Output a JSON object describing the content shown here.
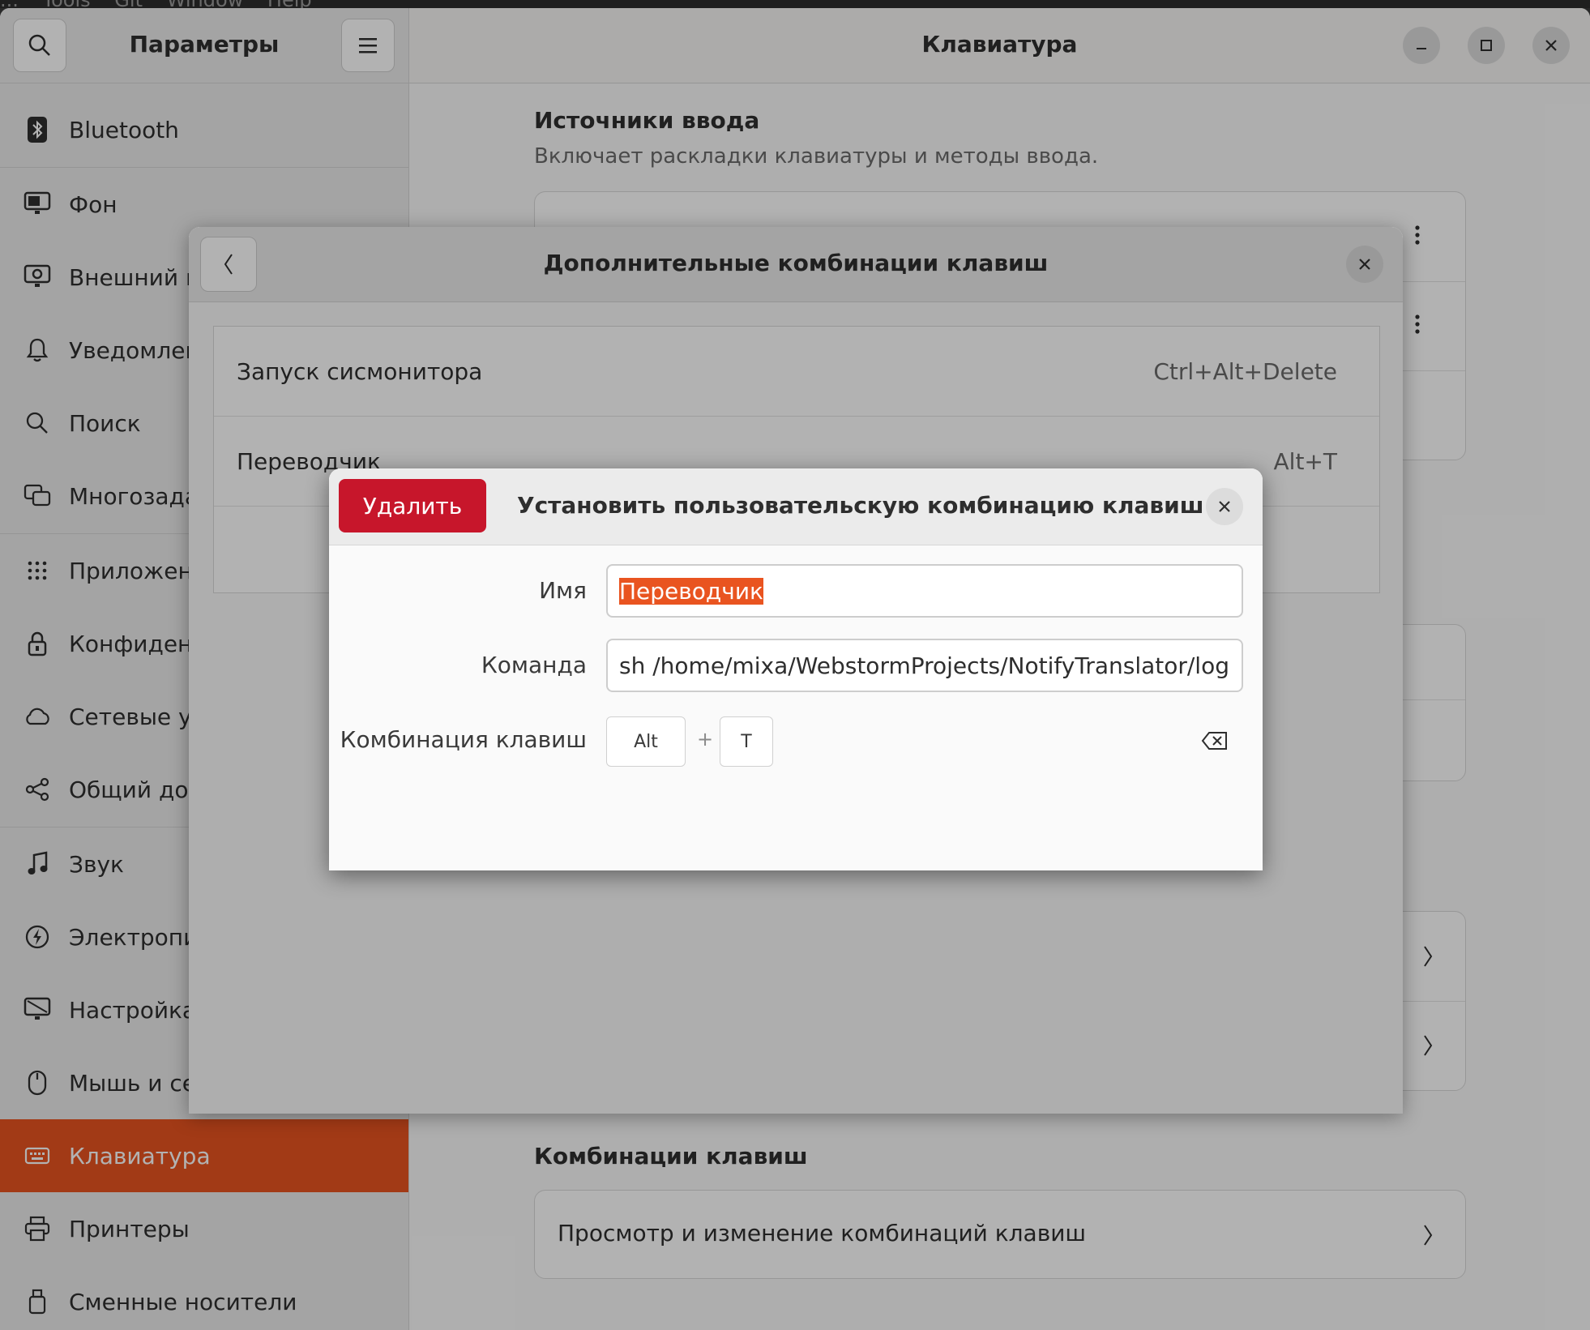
{
  "menubar": {
    "items": [
      "...",
      "Tools",
      "Git",
      "Window",
      "Help"
    ]
  },
  "sidebar": {
    "title": "Параметры",
    "items": [
      {
        "label": "Bluetooth",
        "icon": "bluetooth-icon"
      },
      {
        "label": "Фон",
        "icon": "background-icon"
      },
      {
        "label": "Внешний вид",
        "icon": "appearance-icon"
      },
      {
        "label": "Уведомления",
        "icon": "bell-icon"
      },
      {
        "label": "Поиск",
        "icon": "search-icon"
      },
      {
        "label": "Многозадачность",
        "icon": "multitasking-icon"
      },
      {
        "label": "Приложения",
        "icon": "apps-grid-icon"
      },
      {
        "label": "Конфиденциальность",
        "icon": "lock-icon"
      },
      {
        "label": "Сетевые учётные записи",
        "icon": "cloud-icon"
      },
      {
        "label": "Общий доступ",
        "icon": "share-icon"
      },
      {
        "label": "Звук",
        "icon": "music-note-icon"
      },
      {
        "label": "Электропитание",
        "icon": "power-icon"
      },
      {
        "label": "Настройка экранов",
        "icon": "display-icon"
      },
      {
        "label": "Мышь и сенсорная панель",
        "icon": "mouse-icon"
      },
      {
        "label": "Клавиатура",
        "icon": "keyboard-icon",
        "active": true
      },
      {
        "label": "Принтеры",
        "icon": "printer-icon"
      },
      {
        "label": "Сменные носители",
        "icon": "usb-icon"
      }
    ]
  },
  "main": {
    "title": "Клавиатура",
    "input_sources": {
      "title": "Источники ввода",
      "subtitle": "Включает раскладки клавиатуры и методы ввода."
    },
    "shortcuts": {
      "title": "Комбинации клавиш",
      "row_label": "Просмотр и изменение комбинаций клавиш"
    }
  },
  "custom_shortcuts_dialog": {
    "title": "Дополнительные комбинации клавиш",
    "rows": [
      {
        "name": "Запуск сисмонитора",
        "accel": "Ctrl+Alt+Delete"
      },
      {
        "name": "Переводчик",
        "accel": "Alt+T"
      }
    ]
  },
  "set_shortcut_dialog": {
    "delete_label": "Удалить",
    "title": "Установить пользовательскую комбинацию клавиш",
    "name_label": "Имя",
    "name_value": "Переводчик",
    "command_label": "Команда",
    "command_value": "sh /home/mixa/WebstormProjects/NotifyTranslator/log",
    "shortcut_label": "Комбинация клавиш",
    "keys": [
      "Alt",
      "T"
    ],
    "plus": "+"
  },
  "colors": {
    "accent": "#e95420",
    "destructive": "#c7162b"
  }
}
